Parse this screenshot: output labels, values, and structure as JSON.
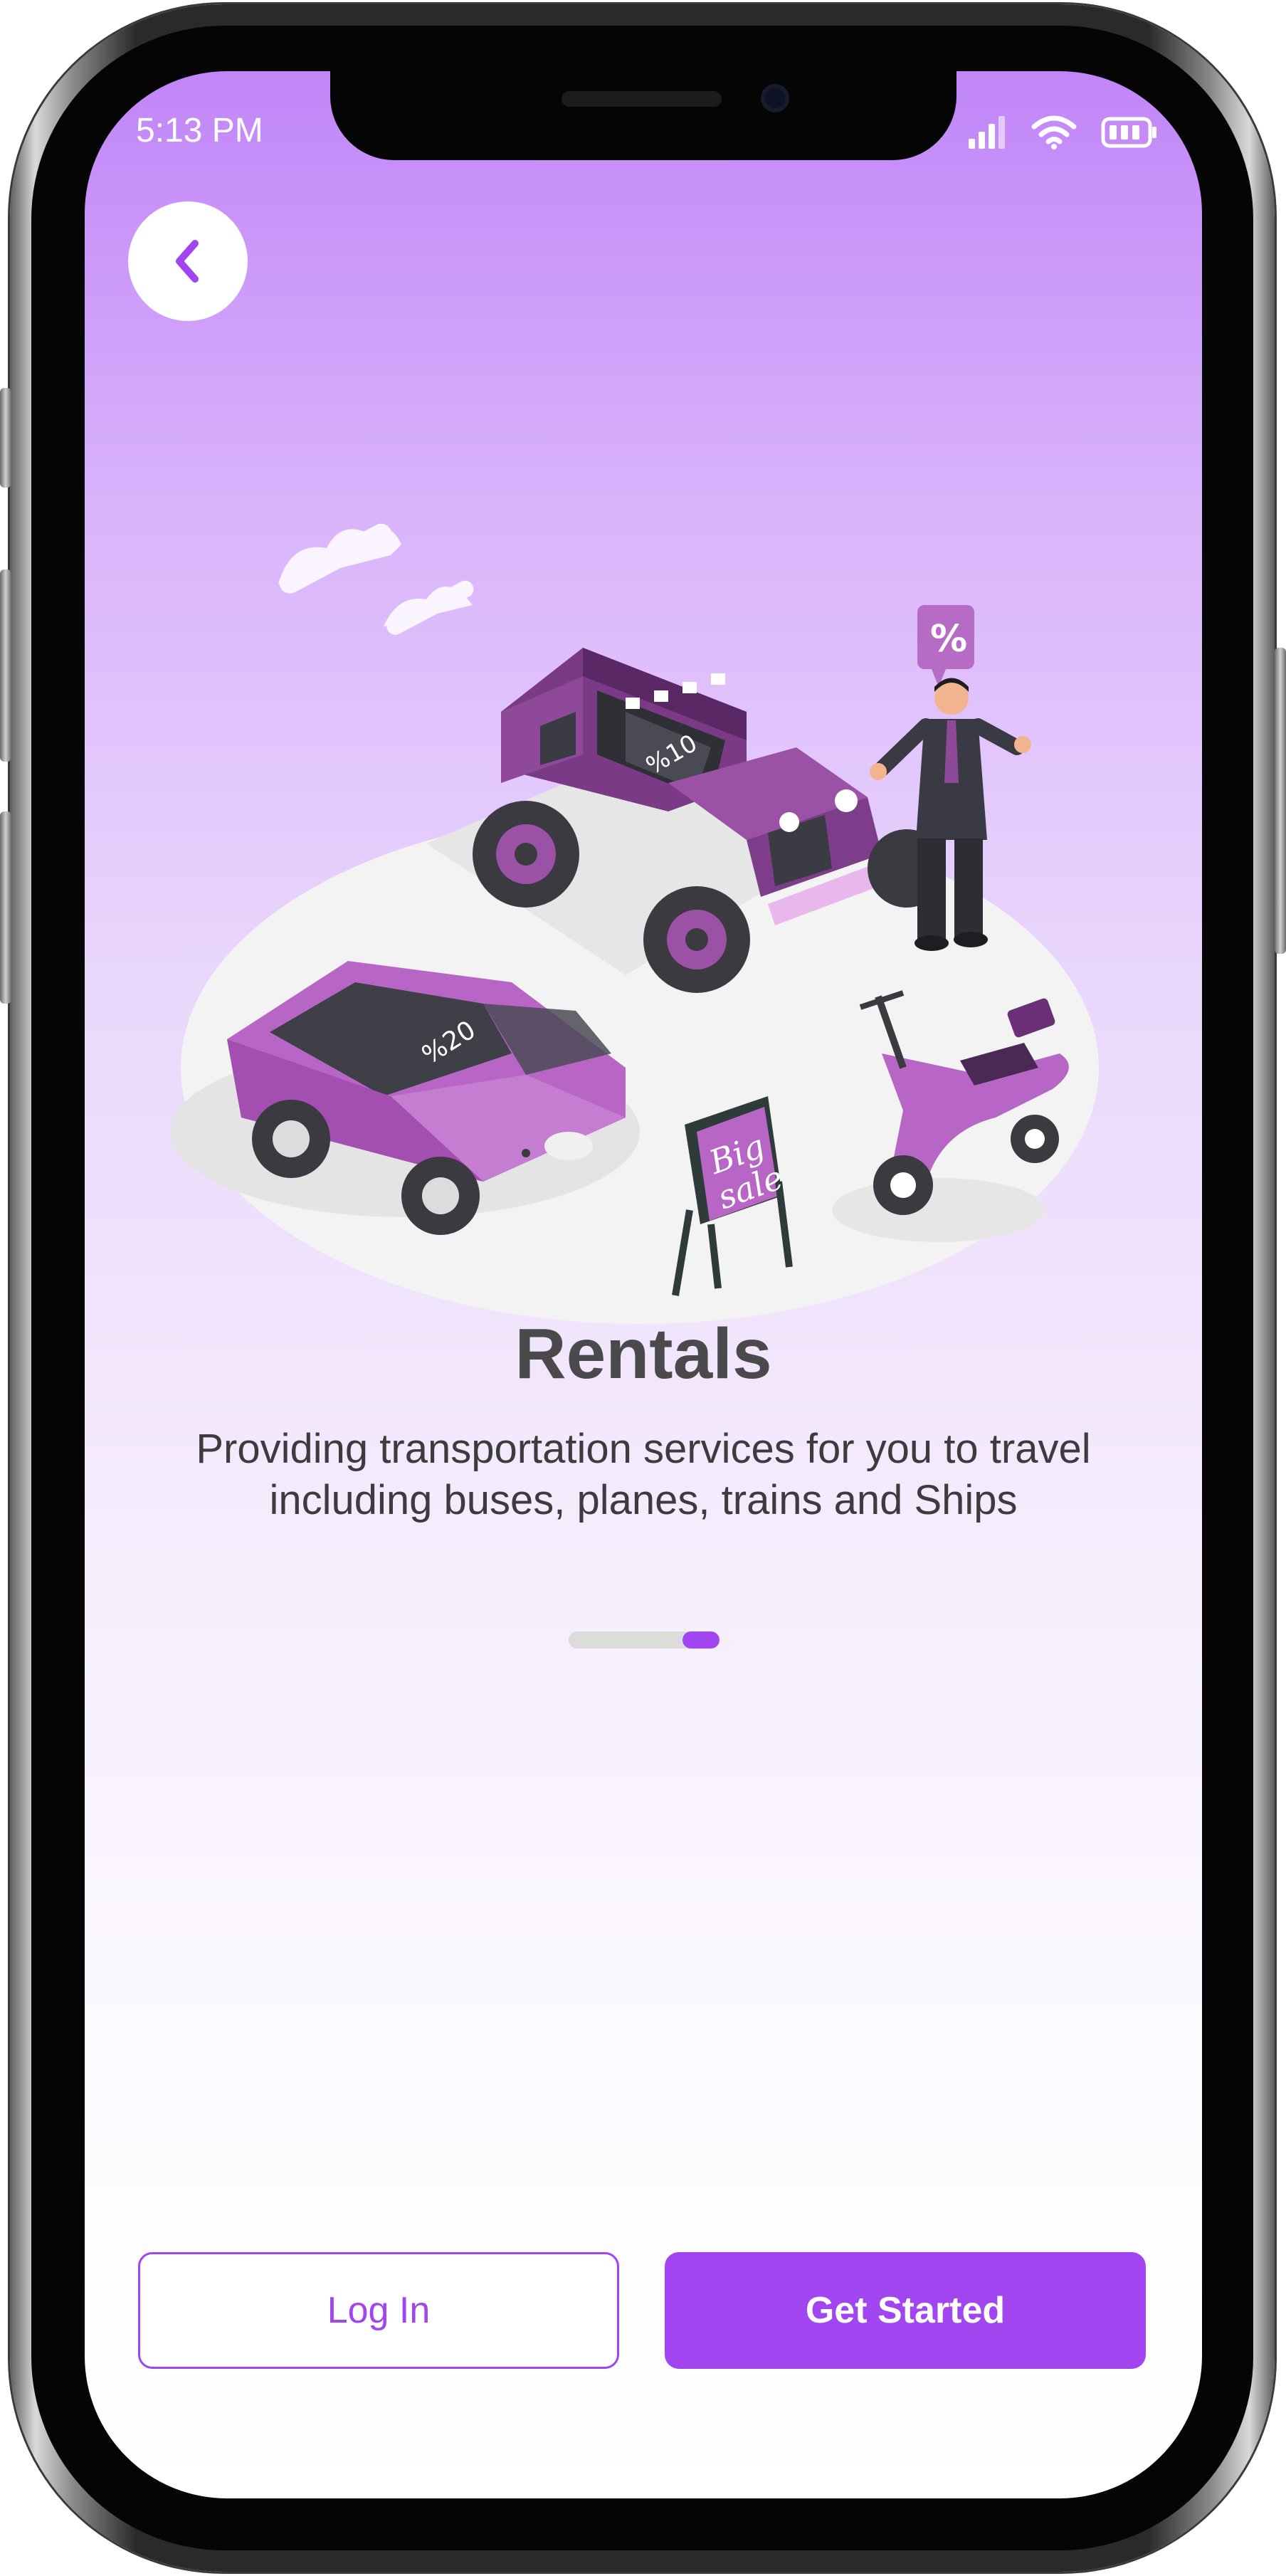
{
  "status": {
    "time": "5:13 PM"
  },
  "onboarding": {
    "title": "Rentals",
    "description": "Providing transportation services for you to travel including buses, planes, trains and Ships",
    "page_indicator": {
      "pages": 2,
      "current": 2
    },
    "illustration": {
      "windshield_tag_1": "%10",
      "windshield_tag_2": "%20",
      "sign_line_1": "Big",
      "sign_line_2": "sale",
      "bubble_text": "%"
    }
  },
  "actions": {
    "login_label": "Log In",
    "get_started_label": "Get Started"
  },
  "colors": {
    "accent": "#a045f0",
    "gradient_top": "#c185f8",
    "text_dark": "#4a4a4c"
  },
  "icons": [
    "chevron-left-icon",
    "signal-icon",
    "wifi-icon",
    "battery-icon"
  ]
}
